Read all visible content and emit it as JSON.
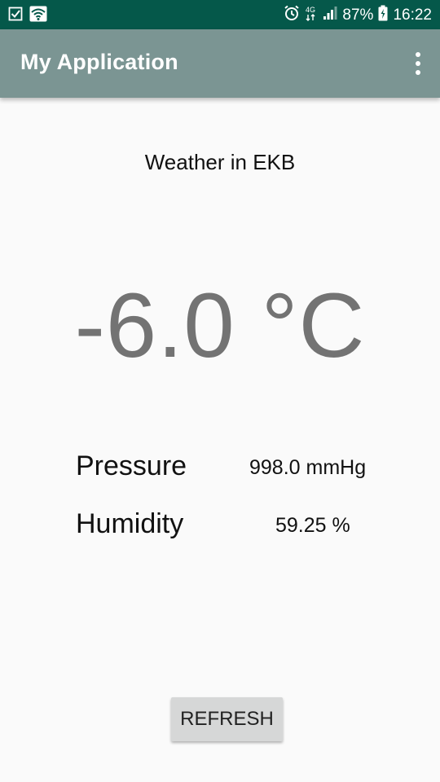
{
  "status_bar": {
    "battery_percent": "87%",
    "time": "16:22",
    "network": "4G",
    "icons": [
      "checklist-icon",
      "wifi-icon",
      "alarm-icon",
      "network-4g-icon",
      "signal-icon",
      "battery-icon"
    ]
  },
  "app_bar": {
    "title": "My Application",
    "overflow_icon": "more-vert-icon",
    "background": "#7b9593"
  },
  "weather": {
    "title": "Weather in EKB",
    "temperature": "-6.0 °C",
    "pressure_label": "Pressure",
    "pressure_value": "998.0 mmHg",
    "humidity_label": "Humidity",
    "humidity_value": "59.25 %"
  },
  "actions": {
    "refresh_label": "REFRESH"
  },
  "colors": {
    "status_bar": "#05584a",
    "temperature_text": "#737373",
    "button_bg": "#d6d7d7"
  }
}
